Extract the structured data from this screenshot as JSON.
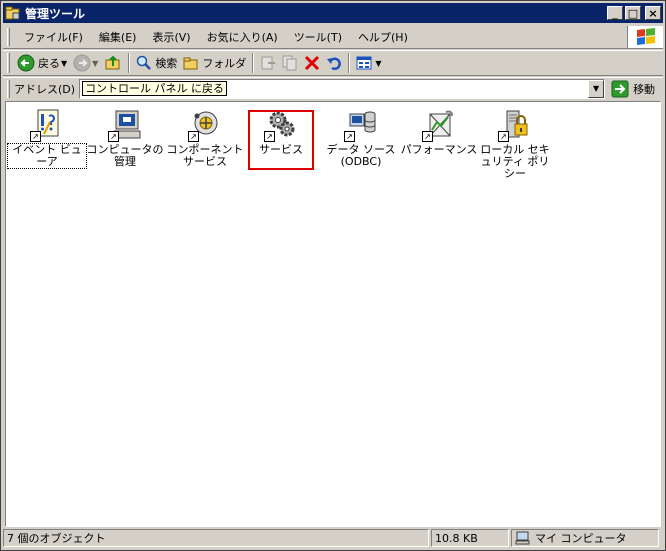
{
  "window": {
    "title": "管理ツール"
  },
  "menu": [
    "ファイル(F)",
    "編集(E)",
    "表示(V)",
    "お気に入り(A)",
    "ツール(T)",
    "ヘルプ(H)"
  ],
  "toolbar": {
    "back_label": "戻る",
    "search_label": "検索",
    "folders_label": "フォルダ"
  },
  "address": {
    "label": "アドレス(D)",
    "tooltip": "コントロール パネル に戻る",
    "go_label": "移動"
  },
  "items": [
    {
      "label": "イベント ビューア",
      "icon": "event-viewer-icon"
    },
    {
      "label": "コンピュータの管理",
      "icon": "computer-management-icon"
    },
    {
      "label": "コンポーネント サービス",
      "icon": "component-services-icon"
    },
    {
      "label": "サービス",
      "icon": "services-icon"
    },
    {
      "label": "データ ソース (ODBC)",
      "icon": "data-sources-icon"
    },
    {
      "label": "パフォーマンス",
      "icon": "performance-icon"
    },
    {
      "label": "ローカル セキュリティ ポリシー",
      "icon": "local-security-policy-icon"
    }
  ],
  "status": {
    "count": "7 個のオブジェクト",
    "size": "10.8 KB",
    "zone": "マイ コンピュータ"
  },
  "colors": {
    "titlebar": "#0a246a",
    "highlight": "#e00000",
    "face": "#d4d0c8"
  }
}
